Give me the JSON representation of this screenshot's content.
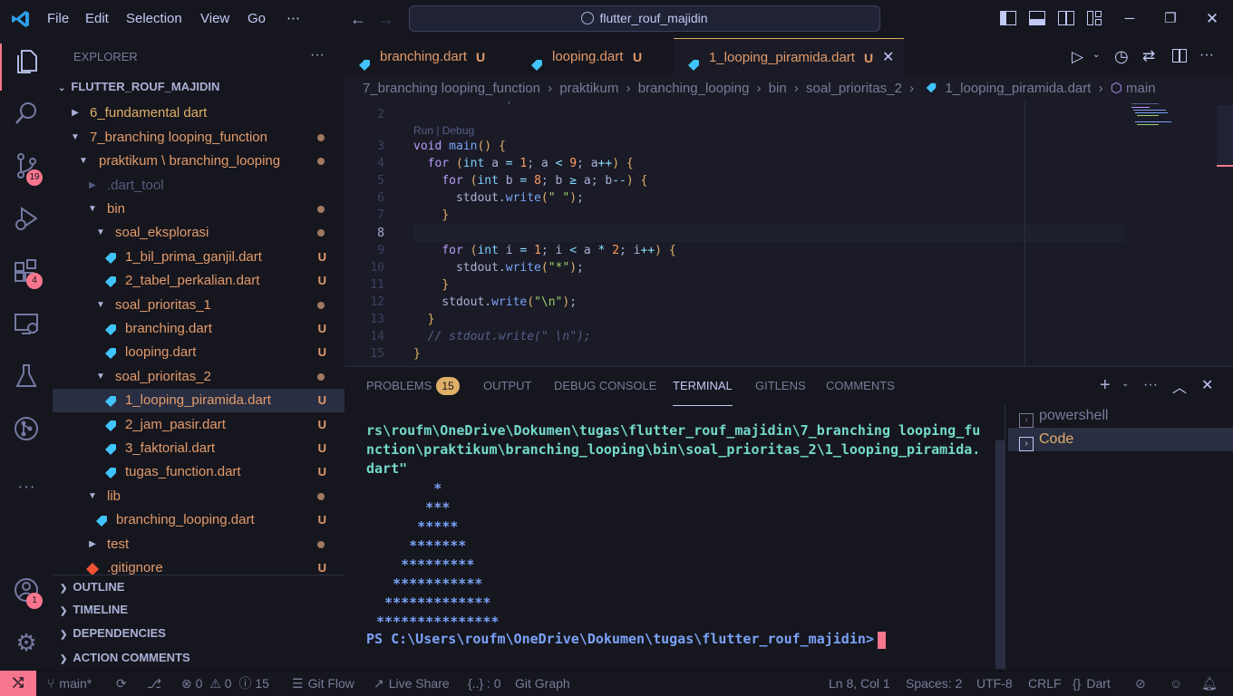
{
  "menu": [
    "File",
    "Edit",
    "Selection",
    "View",
    "Go",
    "⋯"
  ],
  "search_text": "flutter_rouf_majidin",
  "explorer": {
    "title": "EXPLORER",
    "root": "FLUTTER_ROUF_MAJIDIN",
    "items": [
      {
        "label": "6_fundamental dart",
        "status": ""
      },
      {
        "label": "7_branching looping_function",
        "status": "dot"
      },
      {
        "label": "praktikum \\ branching_looping",
        "status": "dot"
      },
      {
        "label": ".dart_tool",
        "status": ""
      },
      {
        "label": "bin",
        "status": "dot"
      },
      {
        "label": "soal_eksplorasi",
        "status": "dot"
      },
      {
        "label": "1_bil_prima_ganjil.dart",
        "status": "U"
      },
      {
        "label": "2_tabel_perkalian.dart",
        "status": "U"
      },
      {
        "label": "soal_prioritas_1",
        "status": "dot"
      },
      {
        "label": "branching.dart",
        "status": "U"
      },
      {
        "label": "looping.dart",
        "status": "U"
      },
      {
        "label": "soal_prioritas_2",
        "status": "dot"
      },
      {
        "label": "1_looping_piramida.dart",
        "status": "U"
      },
      {
        "label": "2_jam_pasir.dart",
        "status": "U"
      },
      {
        "label": "3_faktorial.dart",
        "status": "U"
      },
      {
        "label": "tugas_function.dart",
        "status": "U"
      },
      {
        "label": "lib",
        "status": "dot"
      },
      {
        "label": "branching_looping.dart",
        "status": "U"
      },
      {
        "label": "test",
        "status": "dot"
      },
      {
        "label": ".gitignore",
        "status": "U"
      }
    ],
    "sections": [
      "OUTLINE",
      "TIMELINE",
      "DEPENDENCIES",
      "ACTION COMMENTS"
    ]
  },
  "badges": {
    "source_control": "19",
    "extensions": "4",
    "accounts": "1"
  },
  "tabs": [
    {
      "label": "branching.dart",
      "status": "U"
    },
    {
      "label": "looping.dart",
      "status": "U"
    },
    {
      "label": "1_looping_piramida.dart",
      "status": "U"
    }
  ],
  "breadcrumb": [
    "7_branching looping_function",
    "praktikum",
    "branching_looping",
    "bin",
    "soal_prioritas_2",
    "1_looping_piramida.dart",
    "main"
  ],
  "codelens": "Run | Debug",
  "line_numbers": [
    "2",
    "3",
    "4",
    "5",
    "6",
    "7",
    "8",
    "9",
    "10",
    "11",
    "12",
    "13",
    "14",
    "15"
  ],
  "code_lines": [
    "",
    "void main() {",
    "  for (int a = 1; a < 9; a++) {",
    "    for (int b = 8; b ≥ a; b--) {",
    "      stdout.write(\" \");",
    "    }",
    "",
    "    for (int i = 1; i < a * 2; i++) {",
    "      stdout.write(\"*\");",
    "    }",
    "    stdout.write(\"\\n\");",
    "  }",
    "  // stdout.write(\" \\n\");",
    "}"
  ],
  "panel": {
    "tabs": [
      "PROBLEMS",
      "OUTPUT",
      "DEBUG CONSOLE",
      "TERMINAL",
      "GITLENS",
      "COMMENTS"
    ],
    "problems_count": "15",
    "terminal_lines": [
      "rs\\roufm\\OneDrive\\Dokumen\\tugas\\flutter_rouf_majidin\\7_branching looping_fu",
      "nction\\praktikum\\branching_looping\\bin\\soal_prioritas_2\\1_looping_piramida.",
      "dart\""
    ],
    "pyramid": [
      "       *",
      "      ***",
      "     *****",
      "    *******",
      "   *********",
      "  ***********",
      " *************",
      "***************"
    ],
    "prompt": "PS C:\\Users\\roufm\\OneDrive\\Dokumen\\tugas\\flutter_rouf_majidin>",
    "shells": [
      "powershell",
      "Code"
    ]
  },
  "status": {
    "branch": "main*",
    "errors": "0",
    "warnings": "0",
    "info": "15",
    "git_flow": "Git Flow",
    "live_share": "Live Share",
    "json_count": "{..} : 0",
    "git_graph": "Git Graph",
    "position": "Ln 8, Col 1",
    "spaces": "Spaces: 2",
    "encoding": "UTF-8",
    "eol": "CRLF",
    "language": "Dart"
  },
  "colors": {
    "accent": "#f7768e",
    "background": "#1a1b26",
    "sidebar": "#16161e",
    "modified": "#e39b6a"
  }
}
